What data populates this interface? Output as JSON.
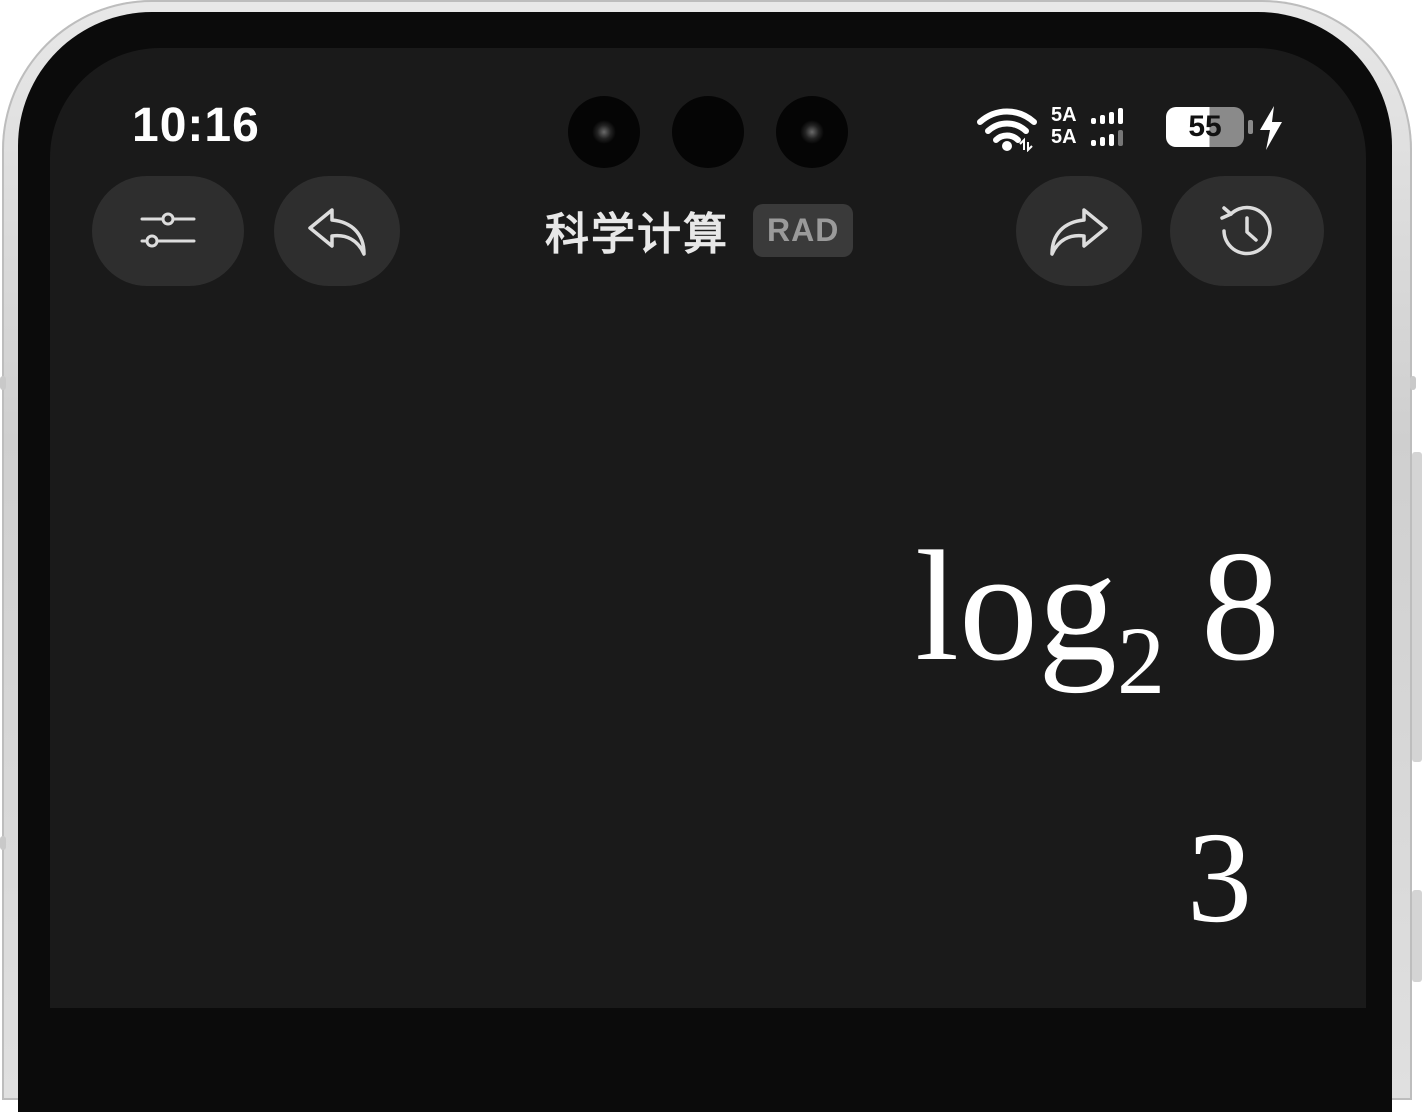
{
  "status_bar": {
    "time": "10:16",
    "network_line1": "5A",
    "network_line2": "5A",
    "battery_level": "55",
    "icons": [
      "wifi-icon",
      "signal-icon",
      "battery-icon",
      "charging-bolt-icon"
    ]
  },
  "toolbar": {
    "settings_icon": "sliders-icon",
    "undo_icon": "undo-arrow-icon",
    "title": "科学计算",
    "mode_badge": "RAD",
    "redo_icon": "redo-arrow-icon",
    "history_icon": "history-clock-icon"
  },
  "display": {
    "expression_fn": "log",
    "expression_base": "2",
    "expression_arg": "8",
    "result": "3"
  },
  "colors": {
    "screen_bg": "#1a1a1a",
    "button_bg": "#2e2e2e",
    "text": "#ffffff",
    "badge_bg": "#3a3a3a",
    "badge_text": "#9a9a9a"
  }
}
